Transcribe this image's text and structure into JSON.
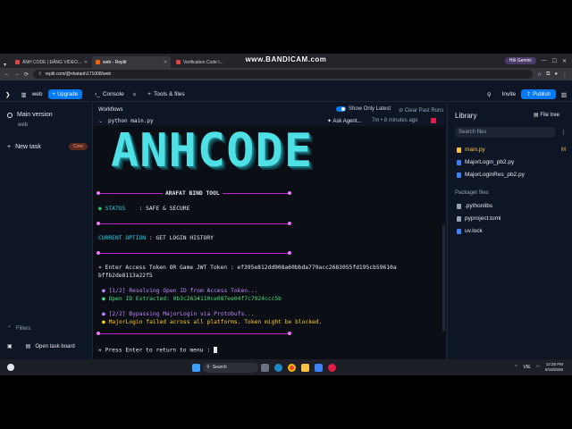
{
  "watermark": "www.BANDICAM.com",
  "browser": {
    "tabs": [
      {
        "label": "ANH CODE | ĐĂNG VIDEO...",
        "active": false
      },
      {
        "label": "web - Replit",
        "active": true
      },
      {
        "label": "Verification Code I...",
        "active": false
      }
    ],
    "gemini": "Hỏi Gemini",
    "url": "replit.com/@nhatanh171008/web"
  },
  "app": {
    "project": "web",
    "upgrade": "Upgrade",
    "console_tab": "Console",
    "tools_tab": "Tools & files",
    "invite": "Invite",
    "publish": "Publish"
  },
  "sidebar": {
    "main_version": "Main version",
    "main_sub": "web",
    "new_task": "New task",
    "core_badge": "Core",
    "filters": "Filters",
    "open_task_board": "Open task board"
  },
  "console": {
    "workflows": "Workflows",
    "show_only_latest": "Show Only Latest",
    "clear_past_runs": "Clear Past Runs",
    "command": "python main.py",
    "ask_agent": "Ask Agent...",
    "run_meta": "7m • 8 minutes ago",
    "banner": "ANHCODE",
    "tool_title": "ARAFAT BIND TOOL",
    "status_label": "STATUS",
    "status_value": ": SAFE & SECURE",
    "option_label": "CURRENT OPTION",
    "option_value": ": GET LOGIN HISTORY",
    "prompt_line1": "» Enter Access Token OR Game JWT Token : ef395e812dd908a60bbda779acc2683055fd195cb59610a",
    "prompt_line2": "bffb2de8113a22f5",
    "step1": "[1/2] Resolving Open ID from Access Token...",
    "step1_result": "Open ID Extracted: 0b3c2634110ce087ee04f7c7924ccc5b",
    "step2": "[2/2] Bypassing MajorLogin via Protobufs...",
    "step2_result": "MajorLogin failed across all platforms. Token might be blocked.",
    "return_prompt": "» Press Enter to return to menu : "
  },
  "library": {
    "title": "Library",
    "file_tree": "File tree",
    "search_placeholder": "Search files",
    "files": [
      {
        "name": "main.py",
        "badge": "M",
        "color": "#f5c542"
      },
      {
        "name": "MajorLogin_pb2.py",
        "badge": "",
        "color": "#3b82f6"
      },
      {
        "name": "MajorLoginRes_pb2.py",
        "badge": "",
        "color": "#3b82f6"
      }
    ],
    "packager_title": "Packager files",
    "packager": [
      {
        "name": ".pythonlibs",
        "color": "#94a3b8"
      },
      {
        "name": "pyproject.toml",
        "color": "#94a3b8"
      },
      {
        "name": "uv.lock",
        "color": "#3b82f6"
      }
    ]
  },
  "taskbar": {
    "search": "Search",
    "lang": "VIE",
    "time": "12:25 PM",
    "date": "6/18/2026"
  },
  "colors": {
    "accent": "#0079f2",
    "terminal_bg": "#0b0e14",
    "banner": "#4fe0e6",
    "separator": "#c026d3"
  }
}
